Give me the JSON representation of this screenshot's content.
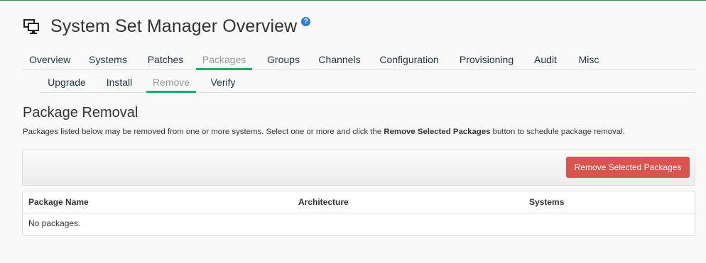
{
  "page": {
    "title": "System Set Manager Overview",
    "title_icon": "system-set-icon",
    "help_icon": "question-circle-icon"
  },
  "tabs": [
    {
      "label": "Overview",
      "active": false
    },
    {
      "label": "Systems",
      "active": false
    },
    {
      "label": "Patches",
      "active": false
    },
    {
      "label": "Packages",
      "active": true
    },
    {
      "label": "Groups",
      "active": false
    },
    {
      "label": "Channels",
      "active": false
    },
    {
      "label": "Configuration",
      "active": false
    },
    {
      "label": "Provisioning",
      "active": false
    },
    {
      "label": "Audit",
      "active": false
    },
    {
      "label": "Misc",
      "active": false
    }
  ],
  "subtabs": [
    {
      "label": "Upgrade",
      "active": false
    },
    {
      "label": "Install",
      "active": false
    },
    {
      "label": "Remove",
      "active": true
    },
    {
      "label": "Verify",
      "active": false
    }
  ],
  "section": {
    "title": "Package Removal",
    "description_before": "Packages listed below may be removed from one or more systems. Select one or more and click the ",
    "description_bold": "Remove Selected Packages",
    "description_after": " button to schedule package removal."
  },
  "toolbar": {
    "remove_label": "Remove Selected Packages"
  },
  "table": {
    "columns": [
      "Package Name",
      "Architecture",
      "Systems"
    ],
    "empty_message": "No packages."
  },
  "colors": {
    "accent_green": "#1ab26b",
    "danger_red": "#d9534f",
    "help_blue": "#2d7ed5"
  }
}
